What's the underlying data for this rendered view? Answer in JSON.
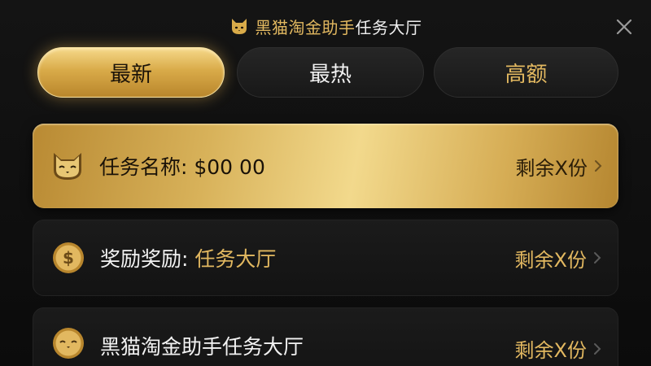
{
  "header": {
    "title_gold": "黑猫淘金助手",
    "title_white": "任务大厅",
    "cat_icon": "cat-face-icon",
    "close_icon": "close-icon"
  },
  "tabs": [
    {
      "label": "最新",
      "active": true
    },
    {
      "label": "最热",
      "active": false
    },
    {
      "label": "高额",
      "active": false
    }
  ],
  "items": [
    {
      "icon": "cat-face-icon",
      "title": "任务名称: $00 00",
      "right": "剩余X份"
    },
    {
      "icon": "dollar-coin-icon",
      "label_a": "奖励奖励: ",
      "label_b": "任务大厅",
      "right": "剩余X份"
    },
    {
      "icon": "cat-coin-icon",
      "title": "黑猫淘金助手任务大厅",
      "right": "剩余X份"
    }
  ],
  "colors": {
    "gold": "#e2b860",
    "gold_light": "#f2d98c",
    "background": "#0b0b0b",
    "card_dark": "#1b1b1b"
  }
}
